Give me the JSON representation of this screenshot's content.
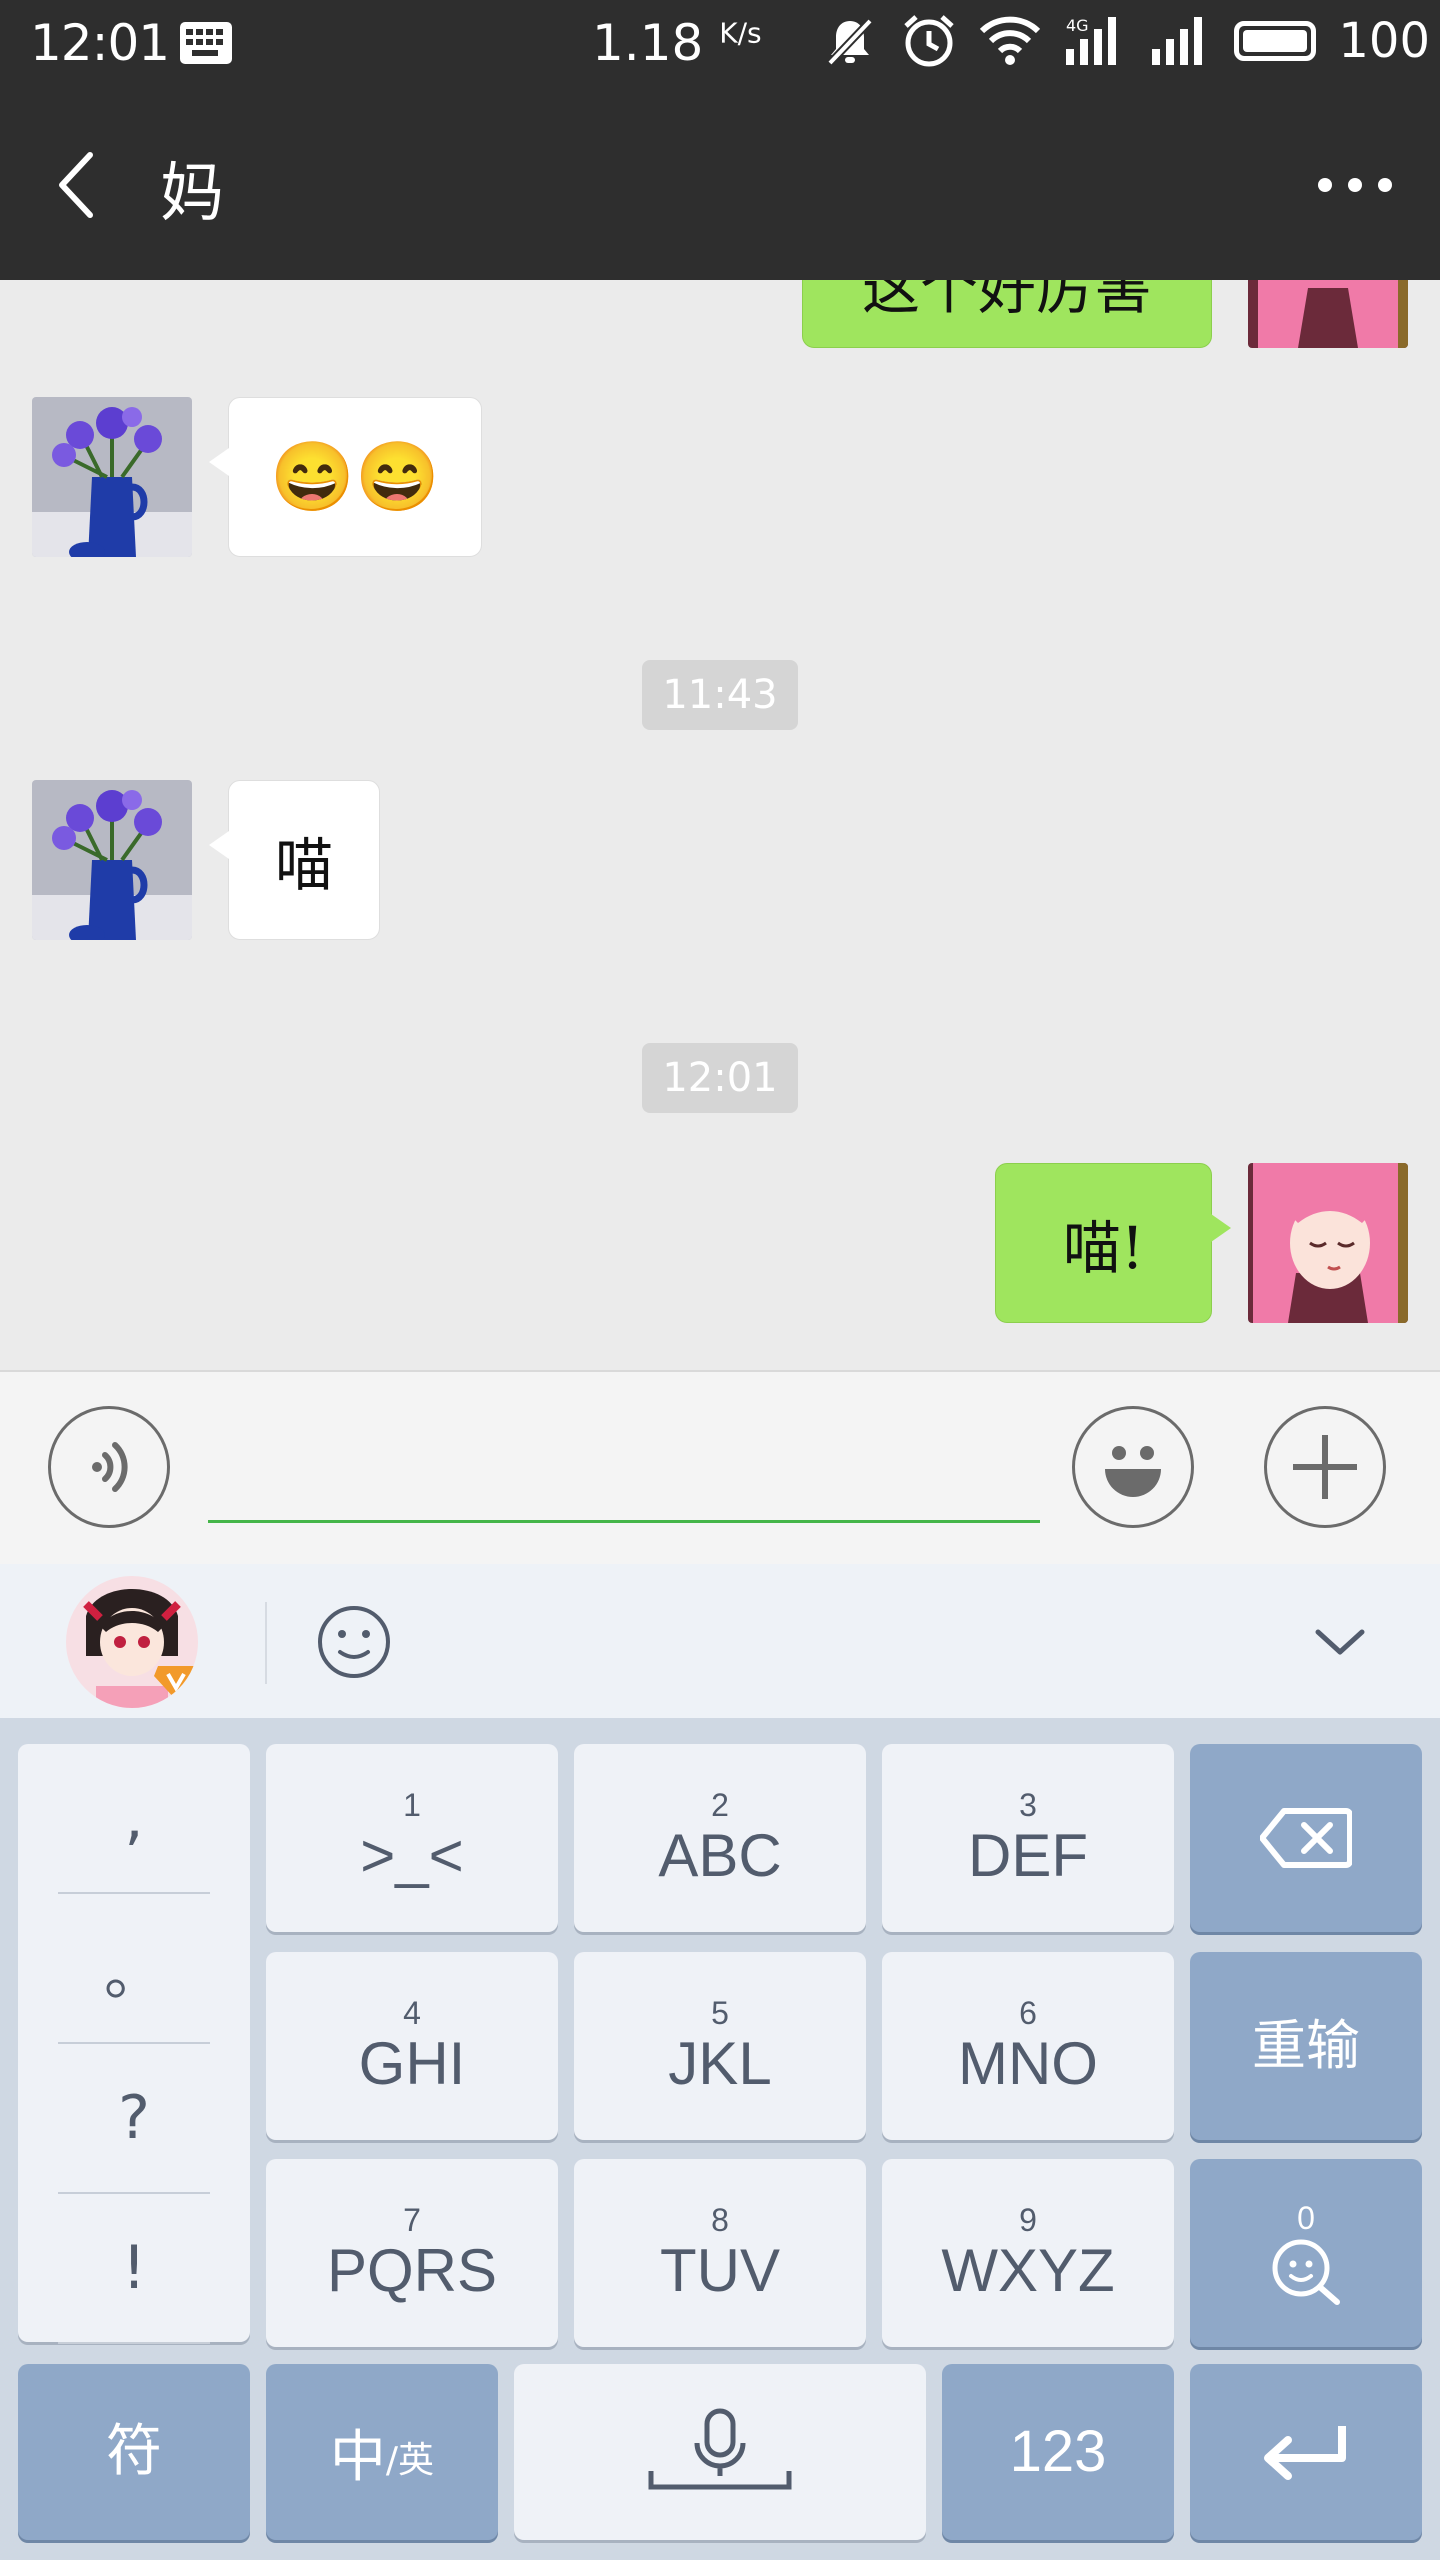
{
  "status_bar": {
    "time": "12:01",
    "speed_value": "1.18",
    "speed_unit": "K/s",
    "battery": "100"
  },
  "header": {
    "title": "妈"
  },
  "chat": {
    "messages": [
      {
        "side": "right",
        "text": "这个好厉害",
        "partial": true
      },
      {
        "side": "left",
        "text": "😄😄"
      },
      {
        "type": "timestamp",
        "text": "11:43"
      },
      {
        "side": "left",
        "text": "喵"
      },
      {
        "type": "timestamp",
        "text": "12:01"
      },
      {
        "side": "right",
        "text": "喵!"
      }
    ]
  },
  "input_bar": {
    "value": ""
  },
  "keyboard": {
    "punctuation": [
      ",",
      "。",
      "?",
      "!"
    ],
    "keys": [
      {
        "num": "1",
        "label": ">_<"
      },
      {
        "num": "2",
        "label": "ABC"
      },
      {
        "num": "3",
        "label": "DEF"
      },
      {
        "num": "4",
        "label": "GHI"
      },
      {
        "num": "5",
        "label": "JKL"
      },
      {
        "num": "6",
        "label": "MNO"
      },
      {
        "num": "7",
        "label": "PQRS"
      },
      {
        "num": "8",
        "label": "TUV"
      },
      {
        "num": "9",
        "label": "WXYZ"
      }
    ],
    "reenter_label": "重输",
    "zero_label": "0",
    "symbols_label": "符",
    "lang_main": "中",
    "lang_alt": "/英",
    "numbers_label": "123"
  },
  "colors": {
    "header_bg": "#2e2e2e",
    "chat_bg": "#ebebeb",
    "bubble_green": "#9fe55e",
    "input_underline": "#44b549",
    "key_dark": "#8fa8c8",
    "key_light": "#eff2f7"
  }
}
